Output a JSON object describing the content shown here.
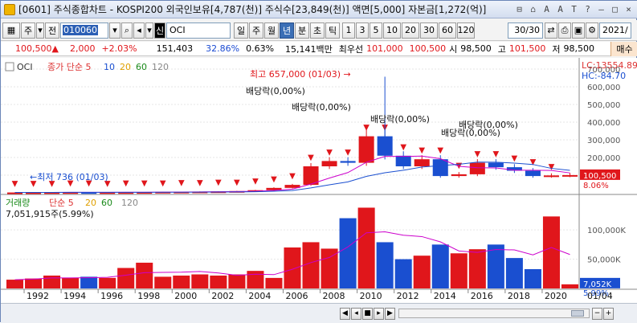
{
  "window": {
    "title": "[0601] 주식종합차트 - KOSPI200 외국인보유[4,787(천)] 주식수[23,849(천)] 액면[5,000] 자본금[1,272(억)]",
    "buttons": [
      "⊟",
      "⌂",
      "A",
      "A",
      "T",
      "?",
      "–",
      "□",
      "×"
    ]
  },
  "toolbar": {
    "period_buttons": [
      "주",
      "전"
    ],
    "code": "010060",
    "name_prefix": "신",
    "name": "OCI",
    "timeframes": [
      "일",
      "주",
      "월",
      "년",
      "분",
      "초",
      "틱"
    ],
    "selected_timeframe": "년",
    "intervals": [
      "1",
      "3",
      "5",
      "10",
      "20",
      "30",
      "60",
      "120"
    ],
    "count": "30/30",
    "date": "2021/"
  },
  "quote": {
    "price": "100,500",
    "change": "2,000",
    "change_pct": "+2.03%",
    "volume": "151,403",
    "turnover": "32.86%",
    "vol_pct": "0.63%",
    "amount": "15,141백만",
    "pref_label": "최우선",
    "ask": "101,000",
    "bid": "100,500",
    "open_label": "시",
    "open": "98,500",
    "high_label": "고",
    "high": "101,500",
    "low_label": "저",
    "low": "98,500",
    "buy": "매수"
  },
  "price_panel": {
    "name": "OCI",
    "legend_label": "종가 단순",
    "ma": [
      "5",
      "10",
      "20",
      "60",
      "120"
    ],
    "lc": "LC:13554.89",
    "hc": "HC:-84.70",
    "ylabels": [
      "700,000",
      "600,000",
      "500,000",
      "400,000",
      "300,000",
      "200,000",
      "100,000"
    ],
    "current": "100,500",
    "current_pct": "8.06%",
    "max_label": "최고 657,000 (01/03)",
    "min_label": "최저 736 (01/03)",
    "dividend_label": "배당락(0,00%)"
  },
  "volume_panel": {
    "title": "거래량",
    "legend_label": "단순",
    "ma": [
      "5",
      "20",
      "60",
      "120"
    ],
    "info": "7,051,915주(5.99%)",
    "ylabels": [
      "100,000K",
      "50,000K"
    ],
    "current": "7,052K",
    "current_pct": "5.99%"
  },
  "xaxis": {
    "labels": [
      "1992",
      "1994",
      "1996",
      "1998",
      "2000",
      "2002",
      "2004",
      "2006",
      "2008",
      "2010",
      "2012",
      "2014",
      "2016",
      "2018",
      "2020"
    ],
    "last": "01/04"
  },
  "chart_data": {
    "type": "candlestick",
    "x": [
      "1991",
      "1992",
      "1993",
      "1994",
      "1995",
      "1996",
      "1997",
      "1998",
      "1999",
      "2000",
      "2001",
      "2002",
      "2003",
      "2004",
      "2005",
      "2006",
      "2007",
      "2008",
      "2009",
      "2010",
      "2011",
      "2012",
      "2013",
      "2014",
      "2015",
      "2016",
      "2017",
      "2018",
      "2019",
      "2020",
      "2021"
    ],
    "close": [
      2000,
      2500,
      3000,
      3500,
      3000,
      3200,
      3500,
      4000,
      5500,
      6000,
      7000,
      8000,
      10000,
      15000,
      28000,
      45000,
      150000,
      180000,
      170000,
      320000,
      210000,
      150000,
      190000,
      95000,
      105000,
      170000,
      145000,
      125000,
      95000,
      98500,
      100500
    ],
    "open": [
      1500,
      2000,
      2500,
      3000,
      3500,
      3000,
      3200,
      3500,
      4000,
      5500,
      6000,
      7000,
      8000,
      10000,
      15000,
      28000,
      45000,
      150000,
      180000,
      170000,
      320000,
      210000,
      150000,
      190000,
      95000,
      105000,
      170000,
      145000,
      125000,
      95000,
      98500
    ],
    "volume_k": [
      15000,
      17000,
      22000,
      18000,
      20000,
      18000,
      35000,
      44000,
      20000,
      22000,
      24000,
      22000,
      24000,
      30000,
      18000,
      70000,
      79000,
      68000,
      120000,
      138000,
      79000,
      50000,
      56000,
      75000,
      60000,
      67000,
      75000,
      52000,
      33000,
      123000,
      7052
    ],
    "ylim": [
      0,
      700000
    ]
  }
}
